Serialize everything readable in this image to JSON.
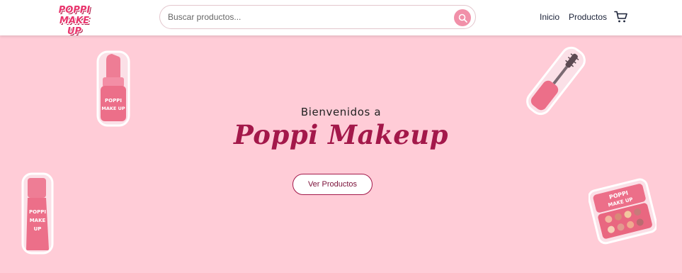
{
  "header": {
    "logo_line1": "POPPI",
    "logo_line2": "MAKE UP",
    "search_placeholder": "Buscar productos...",
    "nav": [
      "Inicio",
      "Productos"
    ]
  },
  "hero": {
    "welcome": "Bienvenidos a",
    "brand": "Poppi Makeup",
    "cta": "Ver Productos"
  },
  "stickers": {
    "lipstick_text1": "POPPI",
    "lipstick_text2": "MAKE UP",
    "tube_text1": "POPPI",
    "tube_text2": "MAKE",
    "tube_text3": "UP",
    "palette_text1": "POPPI",
    "palette_text2": "MAKE UP"
  },
  "colors": {
    "background": "#ffccd7",
    "accent": "#a3184a",
    "search_button": "#f190a9"
  },
  "icons": [
    "search-icon",
    "cart-icon"
  ]
}
